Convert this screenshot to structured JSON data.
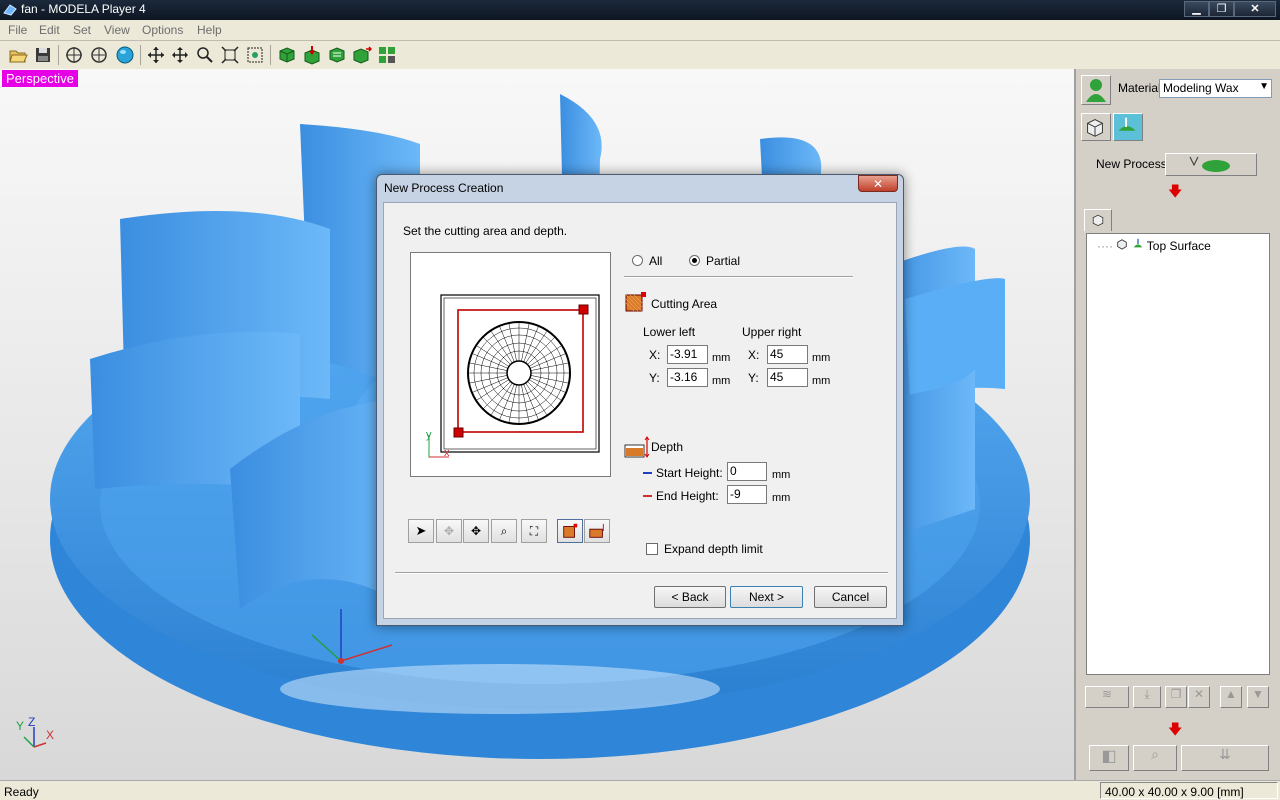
{
  "window": {
    "title": "fan - MODELA Player 4"
  },
  "menu": [
    "File",
    "Edit",
    "Set",
    "View",
    "Options",
    "Help"
  ],
  "toolbar": {
    "icons": [
      "open-icon",
      "save-icon",
      "view-top-icon",
      "view-front-icon",
      "view-perspective-icon",
      "rotate-icon",
      "pan-icon",
      "zoom-icon",
      "fit-icon",
      "zoom-window-icon",
      "model-icon",
      "import-icon",
      "cut-icon",
      "export-icon",
      "layout-icon"
    ]
  },
  "viewport": {
    "view_label": "Perspective",
    "axes": {
      "x": "X",
      "y": "Y",
      "z": "Z"
    },
    "model_color": "#4aa3f0"
  },
  "panel": {
    "material_label": "Material",
    "material_value": "Modeling Wax",
    "new_process_label": "New Process",
    "tree_items": [
      {
        "label": "Top Surface"
      }
    ]
  },
  "dialog": {
    "title": "New Process Creation",
    "close": "✕",
    "instruction": "Set the cutting area and depth.",
    "mode_options": [
      "All",
      "Partial"
    ],
    "mode_selected": "Partial",
    "cutting_area_label": "Cutting Area",
    "lower_left_label": "Lower left",
    "upper_right_label": "Upper right",
    "lower_left": {
      "x_label": "X:",
      "x": "-3.91",
      "y_label": "Y:",
      "y": "-3.16"
    },
    "upper_right": {
      "x_label": "X:",
      "x": "45",
      "y_label": "Y:",
      "y": "45"
    },
    "unit": "mm",
    "depth_label": "Depth",
    "start_height_label": "Start Height:",
    "start_height": "0",
    "end_height_label": "End Height:",
    "end_height": "-9",
    "expand_depth_label": "Expand depth limit",
    "expand_depth_checked": false,
    "preview_axes": {
      "x": "x",
      "y": "y"
    },
    "buttons": {
      "back": "< Back",
      "next": "Next >",
      "cancel": "Cancel"
    }
  },
  "status": {
    "text": "Ready",
    "dimensions": "40.00 x 40.00 x 9.00 [mm]"
  }
}
